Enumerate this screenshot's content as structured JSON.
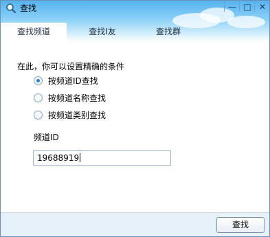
{
  "window": {
    "title": "查找",
    "controls": {
      "minimize": "—",
      "maximize": "□",
      "close": "✕"
    }
  },
  "tabs": [
    {
      "label": "查找频道",
      "active": true
    },
    {
      "label": "查找I友",
      "active": false
    },
    {
      "label": "查找群",
      "active": false
    }
  ],
  "form": {
    "prompt": "在此，你可以设置精确的条件",
    "options": [
      {
        "label": "按频道ID查找",
        "checked": true
      },
      {
        "label": "按频道名称查找",
        "checked": false
      },
      {
        "label": "按频道类别查找",
        "checked": false
      }
    ],
    "field_label": "频道ID",
    "field_value": "19688919"
  },
  "footer": {
    "search_button": "查找"
  },
  "colors": {
    "header_top": "#56b3ee",
    "footer_bg": "#e6f1f9",
    "accent": "#2d7ed6"
  }
}
